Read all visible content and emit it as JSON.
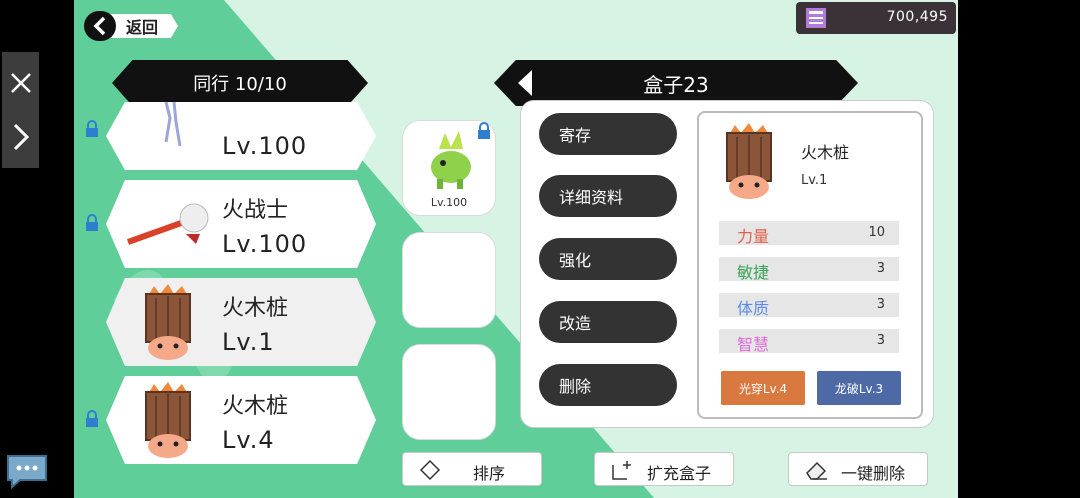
{
  "header": {
    "back_label": "返回",
    "currency_value": "700,495"
  },
  "party": {
    "title": "同行 10/10",
    "items": [
      {
        "name": "",
        "level": "Lv.100"
      },
      {
        "name": "火战士",
        "level": "Lv.100"
      },
      {
        "name": "火木桩",
        "level": "Lv.1"
      },
      {
        "name": "火木桩",
        "level": "Lv.4"
      }
    ]
  },
  "box": {
    "title": "盒子23",
    "first_slot_level": "Lv.100"
  },
  "context_menu": {
    "items": [
      "寄存",
      "详细资料",
      "强化",
      "改造",
      "删除"
    ]
  },
  "detail": {
    "name": "火木桩",
    "level": "Lv.1",
    "stats": [
      {
        "label": "力量",
        "value": "10",
        "color": "#e2614a"
      },
      {
        "label": "敏捷",
        "value": "3",
        "color": "#3aa45a"
      },
      {
        "label": "体质",
        "value": "3",
        "color": "#5b8be6"
      },
      {
        "label": "智慧",
        "value": "3",
        "color": "#e06ad8"
      }
    ],
    "skills": [
      {
        "label": "光穿Lv.4",
        "color": "#d9783f"
      },
      {
        "label": "龙破Lv.3",
        "color": "#4d6aa6"
      }
    ]
  },
  "actions": {
    "sort": "排序",
    "expand": "扩充盒子",
    "delete_all": "一键删除"
  },
  "colors": {
    "background_green": "#5fce99",
    "background_light": "#d6f3e4",
    "dark": "#333333"
  }
}
